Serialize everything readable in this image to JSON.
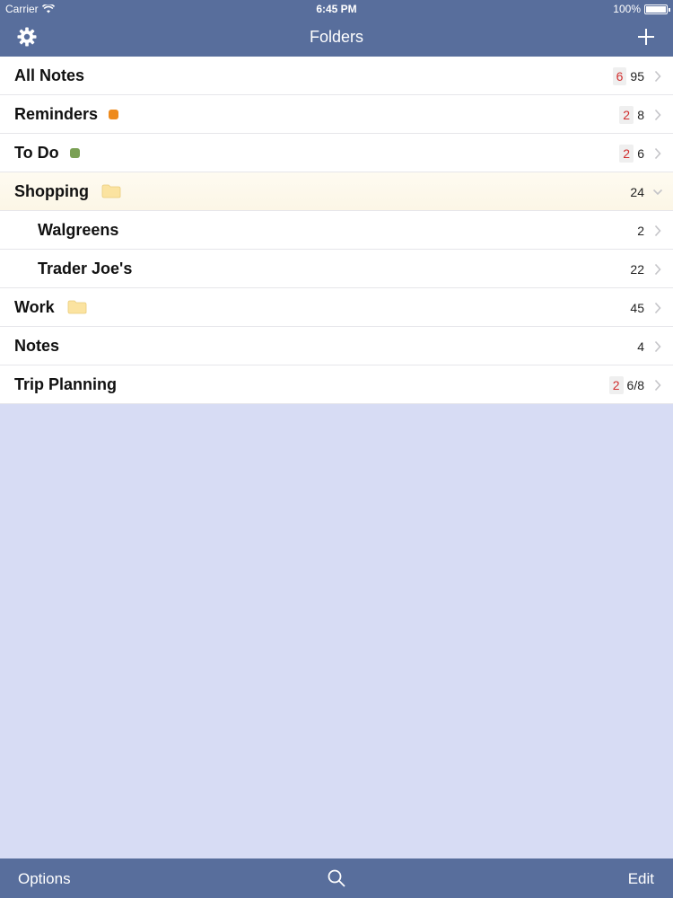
{
  "status_bar": {
    "carrier": "Carrier",
    "time": "6:45 PM",
    "battery": "100%"
  },
  "nav": {
    "title": "Folders",
    "left_icon": "gear-icon",
    "right_icon": "plus-icon"
  },
  "folders": [
    {
      "label": "All Notes",
      "badge": "6",
      "count": "95",
      "expanded": false
    },
    {
      "label": "Reminders",
      "badge": "2",
      "count": "8",
      "tag_color": "#ee8a1c"
    },
    {
      "label": "To Do",
      "badge": "2",
      "count": "6",
      "tag_color": "#7aa054"
    },
    {
      "label": "Shopping",
      "count": "24",
      "icon": "folder-icon",
      "expanded": true
    },
    {
      "label": "Walgreens",
      "count": "2",
      "child": true
    },
    {
      "label": "Trader Joe's",
      "count": "22",
      "child": true
    },
    {
      "label": "Work",
      "count": "45",
      "icon": "folder-icon"
    },
    {
      "label": "Notes",
      "count": "4"
    },
    {
      "label": "Trip Planning",
      "badge": "2",
      "count": "6/8"
    }
  ],
  "toolbar": {
    "options_label": "Options",
    "search_icon": "search-icon",
    "edit_label": "Edit"
  },
  "colors": {
    "bar": "#586e9c",
    "background": "#d7dcf4",
    "badge_text": "#d12e2e",
    "folder": "#fbe3a0"
  }
}
